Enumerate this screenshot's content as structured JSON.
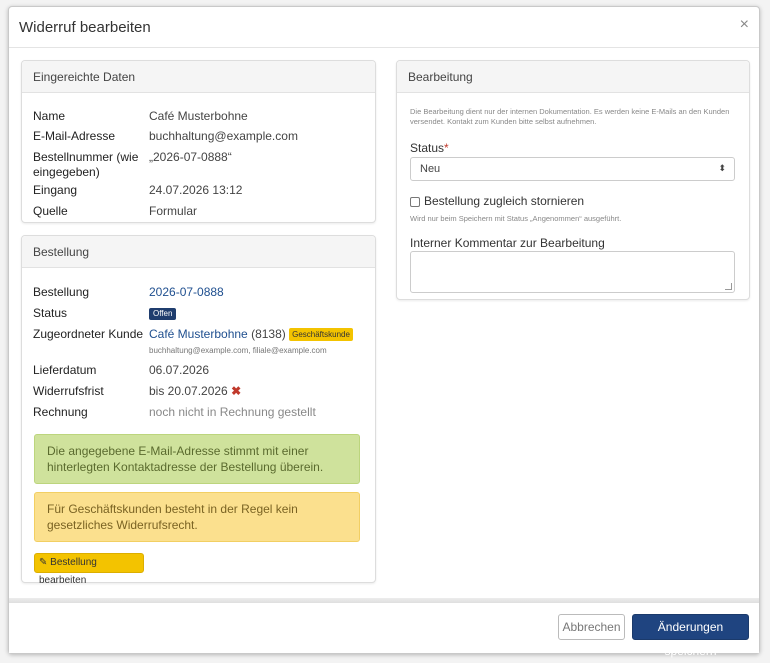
{
  "dialog": {
    "title": "Widerruf bearbeiten",
    "close_symbol": "×"
  },
  "submitted": {
    "header": "Eingereichte Daten",
    "rows": [
      {
        "label": "Name",
        "value": "Café Musterbohne"
      },
      {
        "label": "E-Mail-Adresse",
        "value": "buchhaltung@example.com"
      },
      {
        "label": "Bestellnummer (wie eingegeben)",
        "value": "„2026-07-0888“"
      },
      {
        "label": "Eingang",
        "value": "24.07.2026 13:12"
      },
      {
        "label": "Quelle",
        "value": "Formular"
      }
    ]
  },
  "order": {
    "header": "Bestellung",
    "labels": {
      "order": "Bestellung",
      "status": "Status",
      "customer": "Zugeordneter Kunde",
      "delivery": "Lieferdatum",
      "deadline": "Widerrufsfrist",
      "invoice": "Rechnung"
    },
    "order_number": "2026-07-0888",
    "status_badge": "Offen",
    "customer_name": "Café Musterbohne",
    "customer_id": "(8138)",
    "customer_badge": "Geschäftskunde",
    "customer_emails": "buchhaltung@example.com, filiale@example.com",
    "delivery_date": "06.07.2026",
    "deadline": "bis 20.07.2026",
    "deadline_mark": "✖",
    "invoice": "noch nicht in Rechnung gestellt",
    "alert_green": "Die angegebene E-Mail-Adresse stimmt mit einer hinterlegten Kontaktadresse der Bestellung überein.",
    "alert_yellow": "Für Geschäftskunden besteht in der Regel kein gesetzliches Widerrufsrecht.",
    "edit_button": "Bestellung bearbeiten",
    "edit_icon": "✎"
  },
  "processing": {
    "header": "Bearbeitung",
    "info": "Die Bearbeitung dient nur der internen Dokumentation. Es werden keine E-Mails an den Kunden versendet. Kontakt zum Kunden bitte selbst aufnehmen.",
    "status_label": "Status",
    "required_mark": "*",
    "status_value": "Neu",
    "select_arrow": "⬍",
    "cancel_checkbox_label": "Bestellung zugleich stornieren",
    "cancel_hint": "Wird nur beim Speichern mit Status „Angenommen“ ausgeführt.",
    "comment_label": "Interner Kommentar zur Bearbeitung",
    "comment_value": ""
  },
  "footer": {
    "cancel": "Abbrechen",
    "save": "Änderungen speichern"
  },
  "colors": {
    "primary": "#1f4480",
    "warning": "#f3c300",
    "success_bg": "#cfe29c",
    "warning_bg": "#fbe08e",
    "danger": "#c0392b"
  }
}
